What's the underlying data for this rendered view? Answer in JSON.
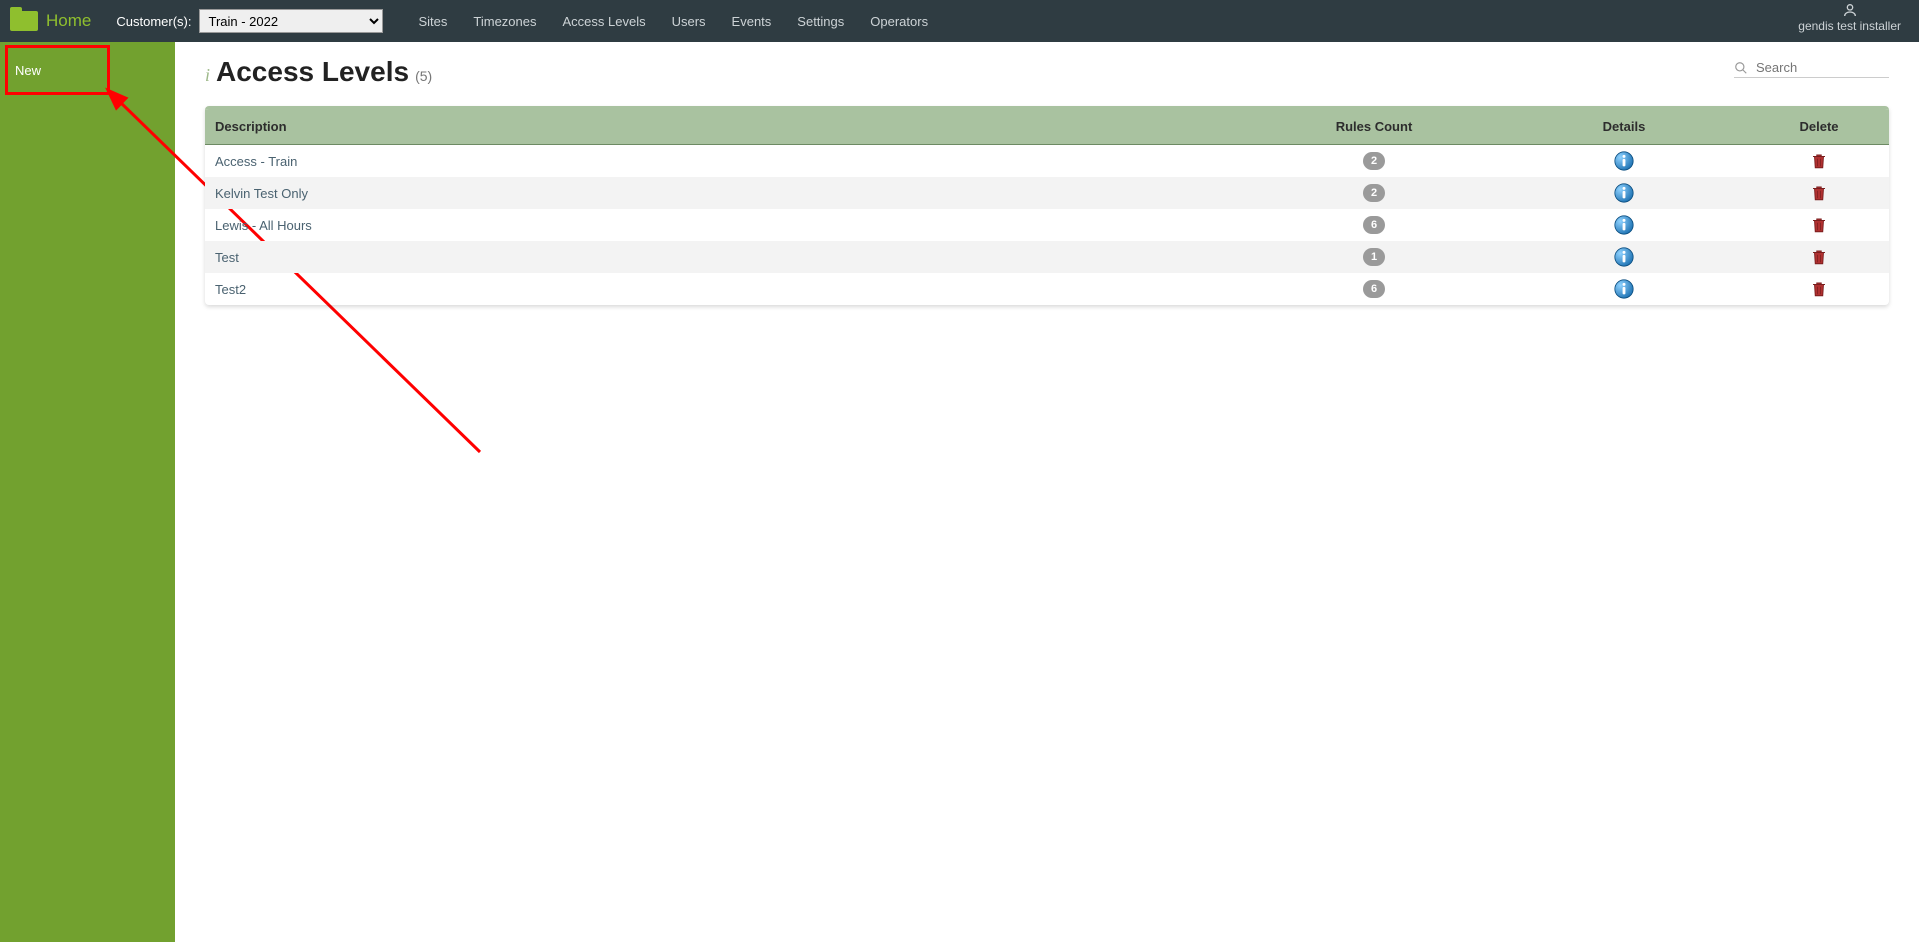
{
  "topbar": {
    "home_label": "Home",
    "customer_label": "Customer(s):",
    "customer_selected": "Train - 2022",
    "nav": [
      "Sites",
      "Timezones",
      "Access Levels",
      "Users",
      "Events",
      "Settings",
      "Operators"
    ],
    "user_name": "gendis test installer"
  },
  "sidebar": {
    "new_label": "New"
  },
  "page": {
    "title": "Access Levels",
    "count": "(5)",
    "search_placeholder": "Search"
  },
  "table": {
    "headers": {
      "description": "Description",
      "rules": "Rules Count",
      "details": "Details",
      "delete": "Delete"
    },
    "rows": [
      {
        "description": "Access - Train",
        "rules": "2"
      },
      {
        "description": "Kelvin Test Only",
        "rules": "2"
      },
      {
        "description": "Lewis - All Hours",
        "rules": "6"
      },
      {
        "description": "Test",
        "rules": "1"
      },
      {
        "description": "Test2",
        "rules": "6"
      }
    ]
  }
}
